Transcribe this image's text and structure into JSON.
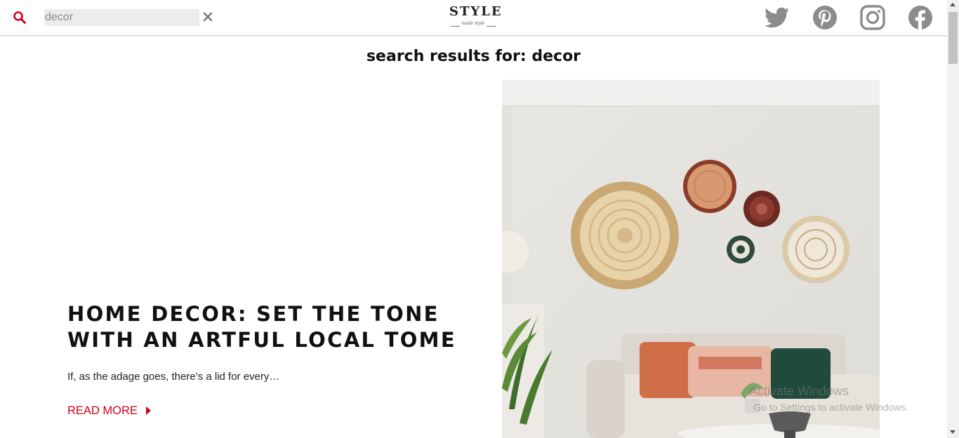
{
  "header": {
    "search_value": "decor",
    "logo_text": "STYLE",
    "logo_tagline": "made style",
    "social": [
      {
        "icon": "twitter-icon",
        "label": "Twitter"
      },
      {
        "icon": "pinterest-icon",
        "label": "Pinterest"
      },
      {
        "icon": "instagram-icon",
        "label": "Instagram"
      },
      {
        "icon": "facebook-icon",
        "label": "Facebook"
      }
    ]
  },
  "main": {
    "results_heading": "search results for: decor",
    "article": {
      "title": "HOME DECOR: SET THE TONE WITH AN ARTFUL LOCAL TOME",
      "excerpt": "If, as the adage goes, there’s a lid for every…",
      "read_more": "READ MORE"
    }
  },
  "watermark": {
    "title": "Activate Windows",
    "subtitle": "Go to Settings to activate Windows."
  },
  "colors": {
    "accent": "#d0021b",
    "social_icon": "#8c8c8c",
    "search_bg": "#ececec",
    "text": "#111111"
  }
}
